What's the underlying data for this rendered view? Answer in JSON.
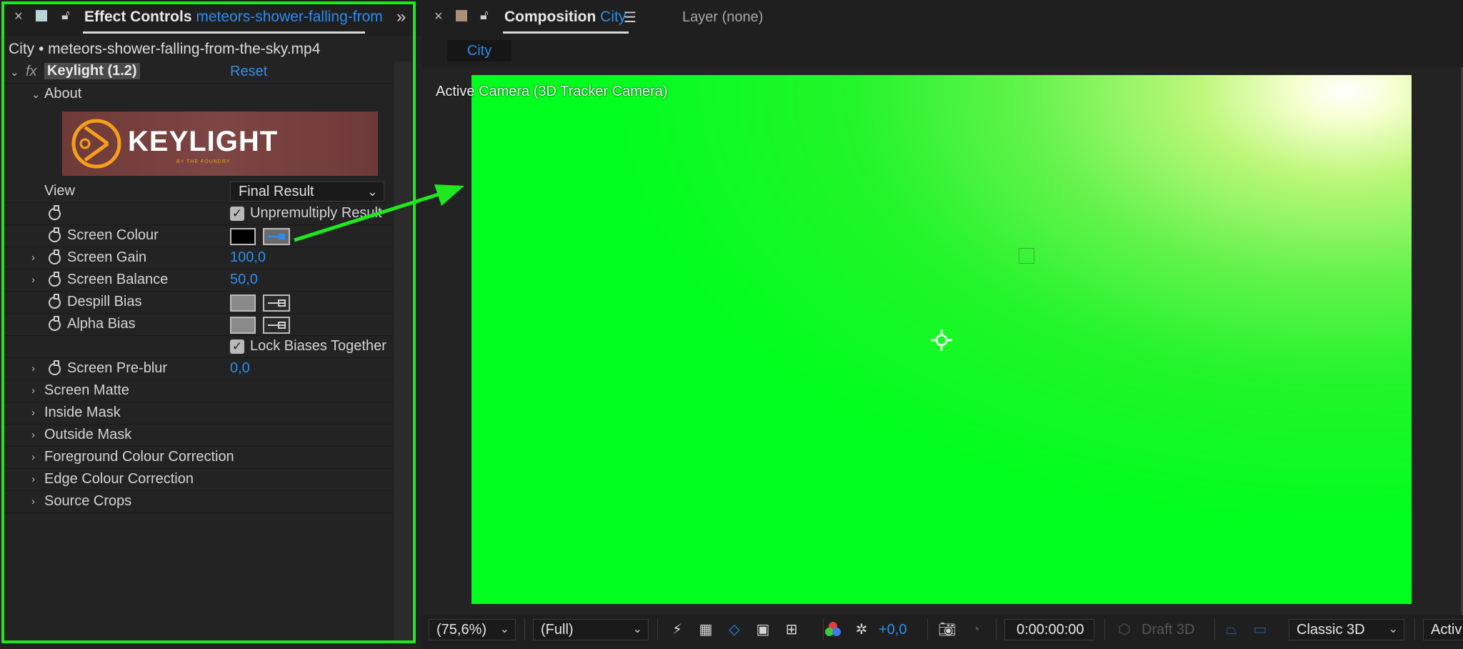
{
  "effect_controls": {
    "tab_label": "Effect Controls",
    "tab_layer": "meteors-shower-falling-from",
    "path": "City • meteors-shower-falling-from-the-sky.mp4",
    "effect_name": "Keylight (1.2)",
    "fx_label": "fx",
    "reset_label": "Reset",
    "about_label": "About",
    "logo_text": "KEYLIGHT",
    "logo_subtext": "BY THE FOUNDRY",
    "params": {
      "view_label": "View",
      "view_value": "Final Result",
      "unpremultiply_label": "Unpremultiply Result",
      "screen_colour_label": "Screen Colour",
      "screen_colour_swatch": "#000000",
      "screen_gain_label": "Screen Gain",
      "screen_gain_value": "100,0",
      "screen_balance_label": "Screen Balance",
      "screen_balance_value": "50,0",
      "despill_bias_label": "Despill Bias",
      "alpha_bias_label": "Alpha Bias",
      "bias_swatch": "#8a8a8a",
      "lock_biases_label": "Lock Biases Together",
      "screen_preblur_label": "Screen Pre-blur",
      "screen_preblur_value": "0,0"
    },
    "groups": [
      "Screen Matte",
      "Inside Mask",
      "Outside Mask",
      "Foreground Colour Correction",
      "Edge Colour Correction",
      "Source Crops"
    ]
  },
  "composition": {
    "tab_label": "Composition",
    "tab_comp": "City",
    "layer_tab": "Layer (none)",
    "subtab": "City",
    "viewer_label": "Active Camera (3D Tracker Camera)",
    "screen_color": "#00ff1e",
    "annotation_color": "#1ee81e"
  },
  "toolbar": {
    "magnification": "(75,6%)",
    "resolution": "(Full)",
    "exposure": "+0,0",
    "timecode": "0:00:00:00",
    "draft_3d": "Draft 3D",
    "renderer": "Classic 3D",
    "view": "Activ"
  }
}
